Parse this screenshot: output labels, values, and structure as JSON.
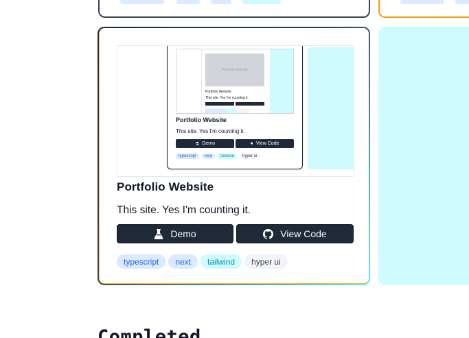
{
  "project": {
    "title": "Portfolio Website",
    "description": "This site. Yes I'm counting it.",
    "demo_label": "Demo",
    "code_label": "View Code",
    "tags": [
      {
        "label": "typescript",
        "color": "blue"
      },
      {
        "label": "next",
        "color": "blue"
      },
      {
        "label": "tailwind",
        "color": "cyan"
      },
      {
        "label": "hyper ui",
        "color": "gray"
      }
    ]
  },
  "preview": {
    "title": "Portfolio Website",
    "description": "This site. Yes I'm counting it.",
    "demo_label": "Demo",
    "code_label": "View Code",
    "tags": [
      "typescript",
      "next",
      "tailwind",
      "hyper ui"
    ],
    "inner_image_label": "Portfolio Website",
    "inner_title": "Portfolio Website",
    "inner_description": "This site. Yes I'm counting it."
  },
  "section": {
    "heading": "Completed"
  },
  "colors": {
    "dark_button": "#1f2937",
    "tag_blue_bg": "#dbeafe",
    "tag_blue_text": "#2563eb",
    "tag_cyan_bg": "#cffafe",
    "tag_cyan_text": "#0891b2",
    "tag_gray_bg": "#f3f4f6",
    "card_border_accent": "#67e8f9",
    "card_border_warm": "#fbbf24"
  },
  "icons": {
    "demo": "flask-icon",
    "code": "github-icon"
  }
}
